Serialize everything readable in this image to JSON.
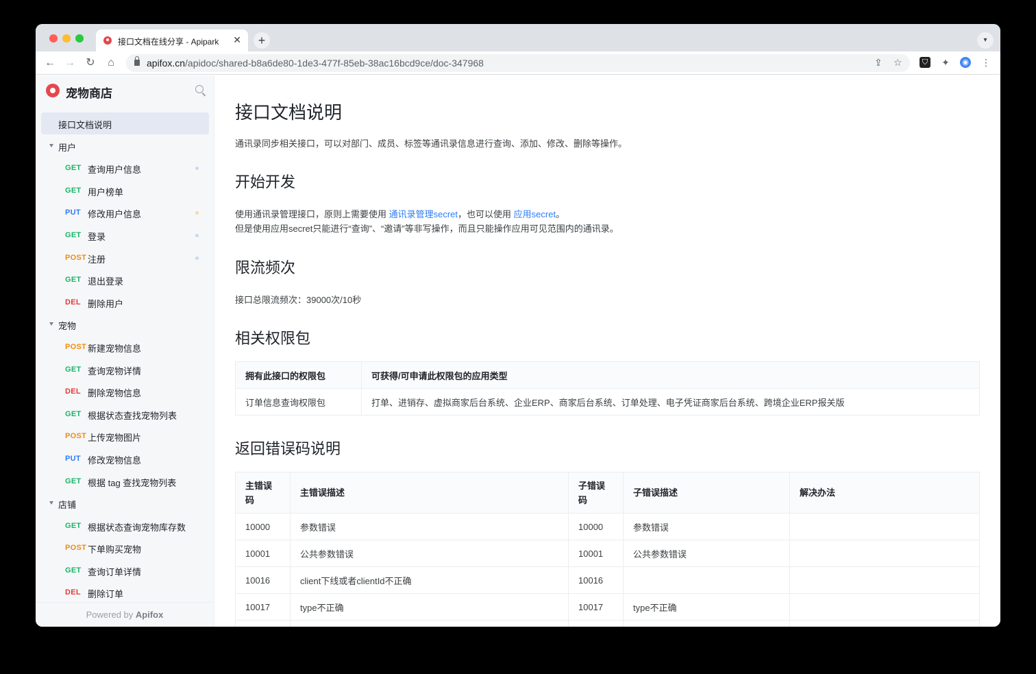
{
  "browser": {
    "tab_title": "接口文档在线分享 - Apipark",
    "tab_close": "✕",
    "new_tab": "+",
    "url_host": "apifox.cn",
    "url_path": "/apidoc/shared-b8a6de80-1de3-477f-85eb-38ac16bcd9ce/doc-347968"
  },
  "sidebar": {
    "brand": "宠物商店",
    "active_item": "接口文档说明",
    "groups": [
      {
        "name": "用户",
        "items": [
          {
            "method": "GET",
            "label": "查询用户信息",
            "dot_color": "#c5d8f7"
          },
          {
            "method": "GET",
            "label": "用户榜单"
          },
          {
            "method": "PUT",
            "label": "修改用户信息",
            "dot_color": "#f7d6b0"
          },
          {
            "method": "GET",
            "label": "登录",
            "dot_color": "#c5d8f7"
          },
          {
            "method": "POST",
            "label": "注册",
            "dot_color": "#c5d8f7"
          },
          {
            "method": "GET",
            "label": "退出登录"
          },
          {
            "method": "DEL",
            "label": "删除用户"
          }
        ]
      },
      {
        "name": "宠物",
        "items": [
          {
            "method": "POST",
            "label": "新建宠物信息"
          },
          {
            "method": "GET",
            "label": "查询宠物详情"
          },
          {
            "method": "DEL",
            "label": "删除宠物信息"
          },
          {
            "method": "GET",
            "label": "根据状态查找宠物列表"
          },
          {
            "method": "POST",
            "label": "上传宠物图片"
          },
          {
            "method": "PUT",
            "label": "修改宠物信息"
          },
          {
            "method": "GET",
            "label": "根据 tag 查找宠物列表"
          }
        ]
      },
      {
        "name": "店铺",
        "items": [
          {
            "method": "GET",
            "label": "根据状态查询宠物库存数"
          },
          {
            "method": "POST",
            "label": "下单购买宠物"
          },
          {
            "method": "GET",
            "label": "查询订单详情"
          },
          {
            "method": "DEL",
            "label": "删除订单"
          }
        ]
      }
    ],
    "powered_prefix": "Powered by ",
    "powered_brand": "Apifox"
  },
  "doc": {
    "title": "接口文档说明",
    "intro": "通讯录同步相关接口，可以对部门、成员、标签等通讯录信息进行查询、添加、修改、删除等操作。",
    "s1_title": "开始开发",
    "s1_line1_a": "使用通讯录管理接口，原则上需要使用 ",
    "s1_link1": "通讯录管理secret",
    "s1_line1_b": "，也可以使用 ",
    "s1_link2": "应用secret",
    "s1_line1_c": "。",
    "s1_line2": "但是使用应用secret只能进行“查询”、“邀请”等非写操作，而且只能操作应用可见范围内的通讯录。",
    "s2_title": "限流频次",
    "s2_text": "接口总限流频次：39000次/10秒",
    "s3_title": "相关权限包",
    "perm_table": {
      "headers": [
        "拥有此接口的权限包",
        "可获得/可申请此权限包的应用类型"
      ],
      "rows": [
        [
          "订单信息查询权限包",
          "打单、进销存、虚拟商家后台系统、企业ERP、商家后台系统、订单处理、电子凭证商家后台系统、跨境企业ERP报关版"
        ]
      ]
    },
    "s4_title": "返回错误码说明",
    "err_table": {
      "headers": [
        "主错误码",
        "主错误描述",
        "子错误码",
        "子错误描述",
        "解决办法"
      ],
      "rows": [
        [
          "10000",
          "参数错误",
          "10000",
          "参数错误",
          ""
        ],
        [
          "10001",
          "公共参数错误",
          "10001",
          "公共参数错误",
          ""
        ],
        [
          "10016",
          "client下线或者clientId不正确",
          "10016",
          "",
          ""
        ],
        [
          "10017",
          "type不正确",
          "10017",
          "type不正确",
          ""
        ],
        [
          "",
          "",
          "",
          "",
          ""
        ]
      ]
    }
  },
  "colors": {
    "get": "#18b566",
    "put": "#2d7cf6",
    "post": "#f28b10",
    "del": "#e53935",
    "link": "#2d7cf6"
  }
}
